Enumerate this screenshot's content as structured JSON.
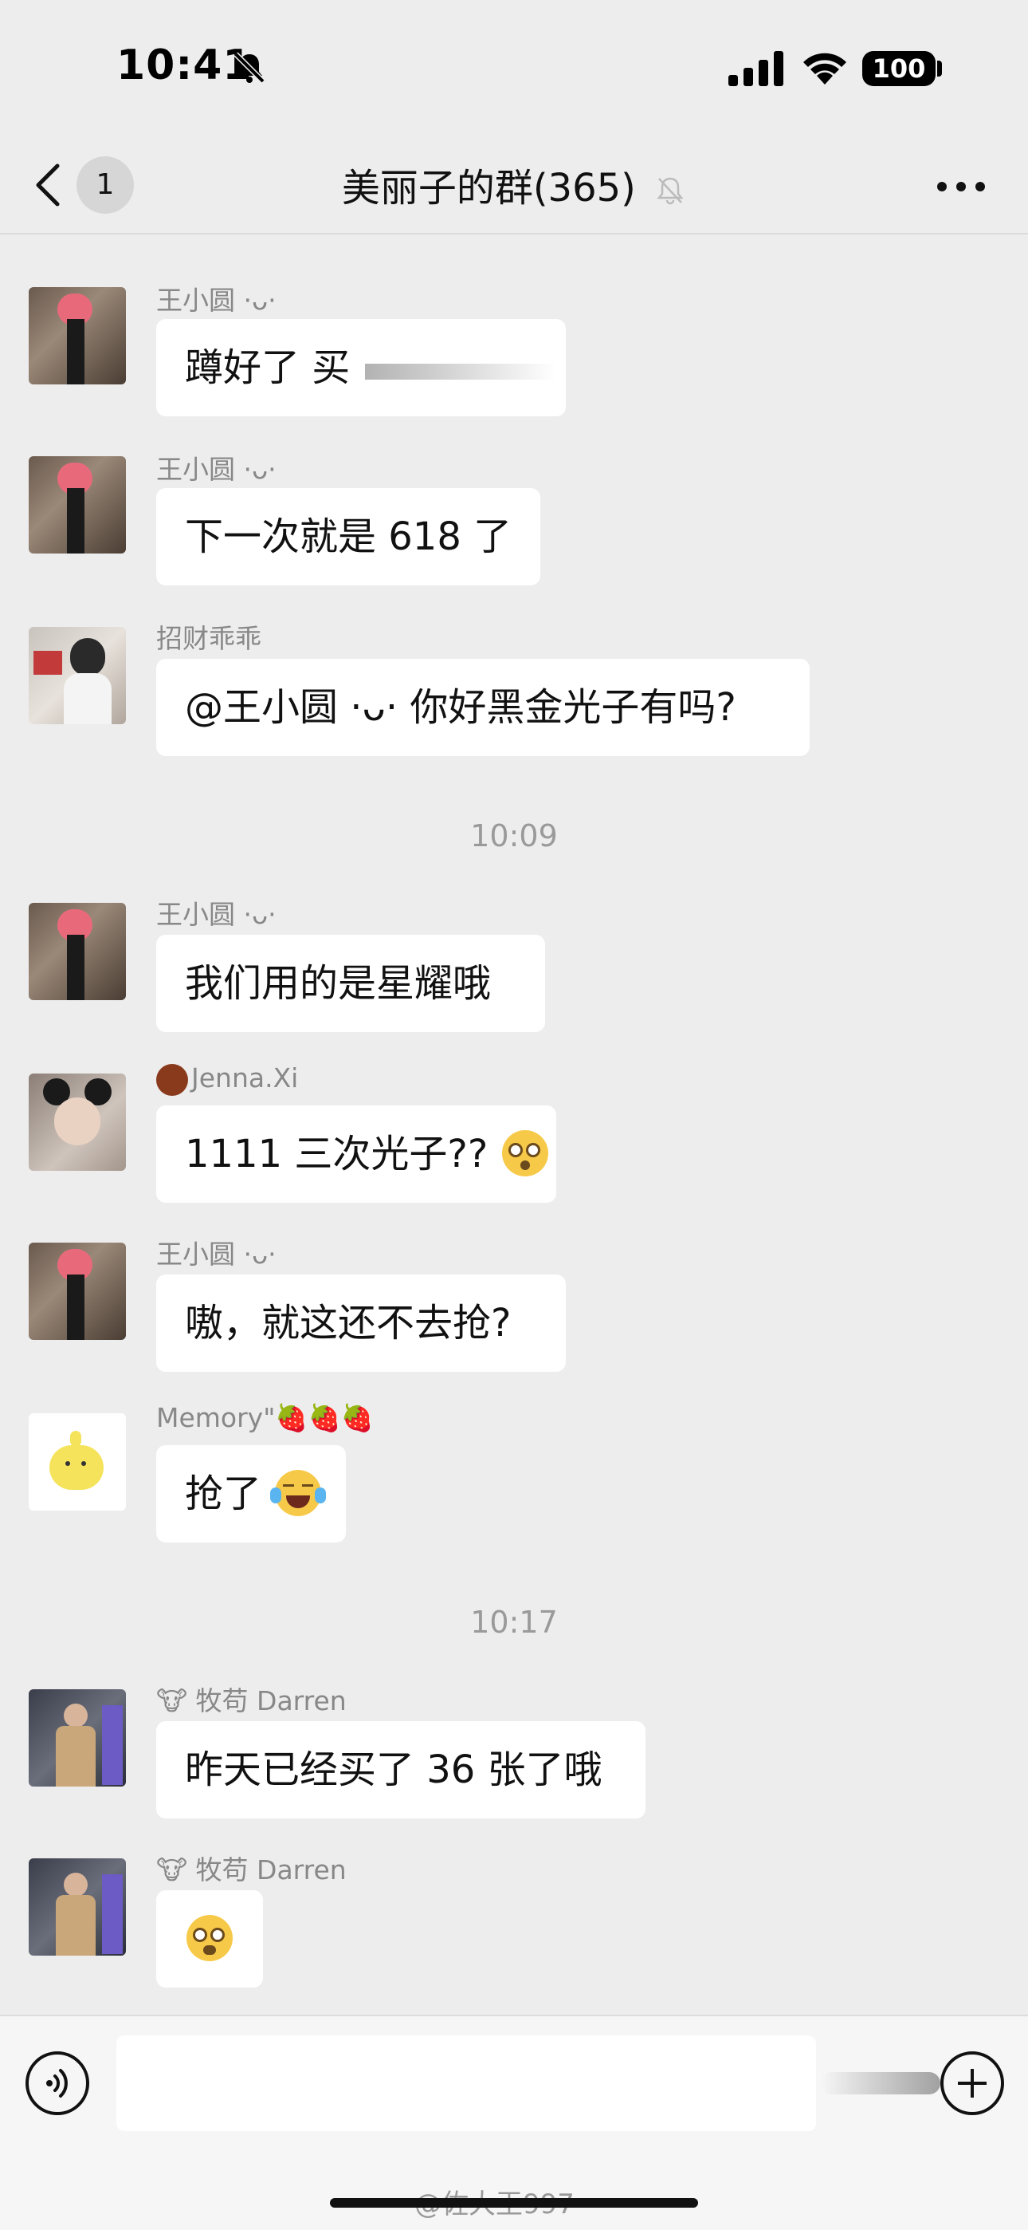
{
  "status_bar": {
    "time": "10:41",
    "battery": "100"
  },
  "nav": {
    "back_count": "1",
    "title": "美丽子的群(365)"
  },
  "messages": [
    {
      "sender": "王小圆 ·ᴗ·",
      "text": "蹲好了 买"
    },
    {
      "sender": "王小圆 ·ᴗ·",
      "text": "下一次就是 618 了"
    },
    {
      "sender": "招财乖乖",
      "text": "@王小圆 ·ᴗ· 你好黑金光子有吗?"
    },
    {
      "sender": "王小圆 ·ᴗ·",
      "text": "我们用的是星耀哦"
    },
    {
      "sender": "Jenna.Xi",
      "text": "1111 三次光子??"
    },
    {
      "sender": "王小圆 ·ᴗ·",
      "text": "嗷，就这还不去抢?"
    },
    {
      "sender": "Memory\"🍓🍓🍓",
      "text": "抢了"
    },
    {
      "sender": "🐮 牧苟 Darren",
      "text": "昨天已经买了 36 张了哦"
    },
    {
      "sender": "🐮 牧苟 Darren",
      "text": ""
    }
  ],
  "timestamps": [
    "10:09",
    "10:17"
  ],
  "watermark": "@佐大王997",
  "icons": {
    "back": "chevron-left-icon",
    "mute": "bell-slash-icon",
    "more": "more-dots-icon",
    "voice": "voice-icon",
    "plus": "plus-icon"
  },
  "colors": {
    "background": "#ededed",
    "bubble": "#ffffff",
    "meta_text": "#888888"
  }
}
